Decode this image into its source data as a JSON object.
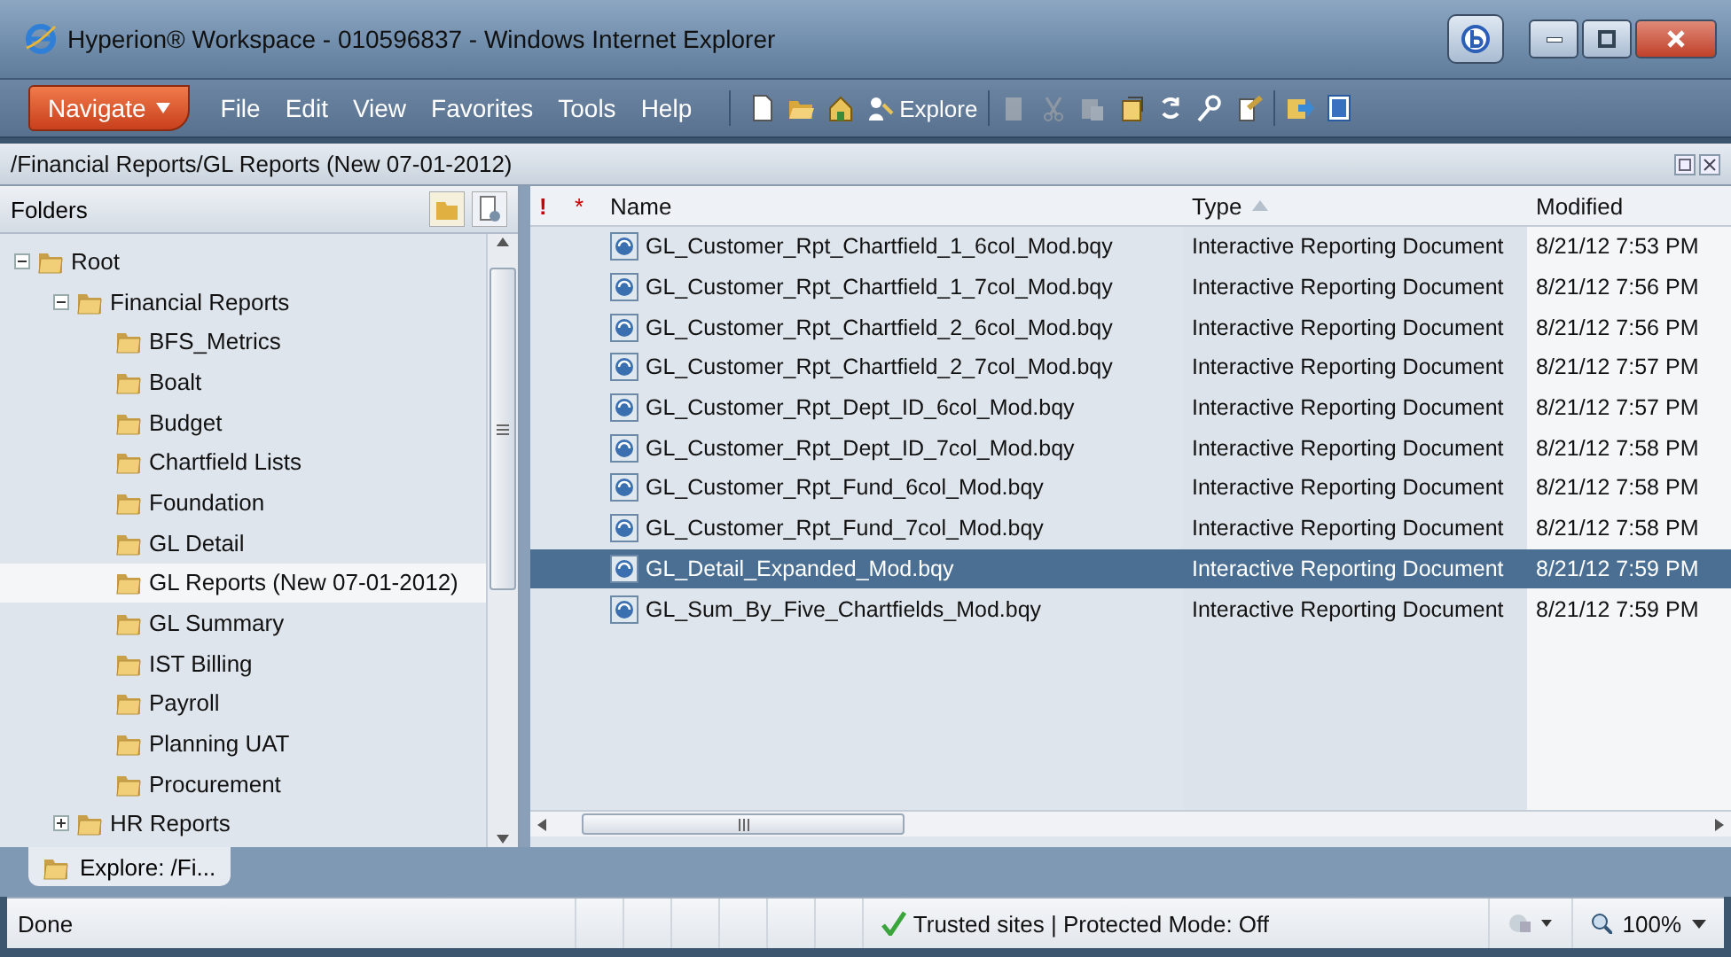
{
  "window": {
    "title": "Hyperion® Workspace - 010596837 - Windows Internet Explorer"
  },
  "toolbar": {
    "navigate": "Navigate",
    "menus": [
      "File",
      "Edit",
      "View",
      "Favorites",
      "Tools",
      "Help"
    ],
    "tools": [
      {
        "kind": "icon",
        "disabled": false
      },
      {
        "kind": "icon",
        "disabled": false
      },
      {
        "kind": "icon",
        "disabled": false
      },
      {
        "kind": "text",
        "label": "Explore",
        "disabled": false
      },
      {
        "kind": "separator"
      },
      {
        "kind": "icon",
        "disabled": true
      },
      {
        "kind": "icon",
        "disabled": true
      },
      {
        "kind": "icon",
        "disabled": true
      },
      {
        "kind": "icon",
        "disabled": false
      },
      {
        "kind": "icon",
        "disabled": false
      },
      {
        "kind": "icon",
        "disabled": false
      },
      {
        "kind": "icon",
        "disabled": false
      },
      {
        "kind": "separator"
      },
      {
        "kind": "icon",
        "disabled": false
      },
      {
        "kind": "icon",
        "disabled": false
      }
    ]
  },
  "path_bar": {
    "path": "/Financial Reports/GL Reports (New 07-01-2012)"
  },
  "folders": {
    "title": "Folders",
    "tree": [
      {
        "label": "Root",
        "expanded": true,
        "selected": false,
        "children": [
          {
            "label": "Financial Reports",
            "expanded": true,
            "selected": false,
            "children": [
              {
                "label": "BFS_Metrics",
                "selected": false
              },
              {
                "label": "Boalt",
                "selected": false
              },
              {
                "label": "Budget",
                "selected": false
              },
              {
                "label": "Chartfield Lists",
                "selected": false
              },
              {
                "label": "Foundation",
                "selected": false
              },
              {
                "label": "GL Detail",
                "selected": false
              },
              {
                "label": "GL Reports (New 07-01-2012)",
                "selected": true
              },
              {
                "label": "GL Summary",
                "selected": false
              },
              {
                "label": "IST Billing",
                "selected": false
              },
              {
                "label": "Payroll",
                "selected": false
              },
              {
                "label": "Planning UAT",
                "selected": false
              },
              {
                "label": "Procurement",
                "selected": false
              }
            ]
          },
          {
            "label": "HR Reports",
            "expanded": false,
            "selected": false
          }
        ]
      }
    ]
  },
  "explore_tab": {
    "label": "Explore: /Fi..."
  },
  "file_list": {
    "columns": [
      {
        "label": "!",
        "sorted": false
      },
      {
        "label": "*",
        "sorted": false
      },
      {
        "label": "Name",
        "sorted": false
      },
      {
        "label": "Type",
        "sorted": true
      },
      {
        "label": "Modified",
        "sorted": false
      }
    ],
    "rows": [
      {
        "name": "GL_Customer_Rpt_Chartfield_1_6col_Mod.bqy",
        "type": "Interactive Reporting Document",
        "modified": "8/21/12 7:53 PM",
        "selected": false
      },
      {
        "name": "GL_Customer_Rpt_Chartfield_1_7col_Mod.bqy",
        "type": "Interactive Reporting Document",
        "modified": "8/21/12 7:56 PM",
        "selected": false
      },
      {
        "name": "GL_Customer_Rpt_Chartfield_2_6col_Mod.bqy",
        "type": "Interactive Reporting Document",
        "modified": "8/21/12 7:56 PM",
        "selected": false
      },
      {
        "name": "GL_Customer_Rpt_Chartfield_2_7col_Mod.bqy",
        "type": "Interactive Reporting Document",
        "modified": "8/21/12 7:57 PM",
        "selected": false
      },
      {
        "name": "GL_Customer_Rpt_Dept_ID_6col_Mod.bqy",
        "type": "Interactive Reporting Document",
        "modified": "8/21/12 7:57 PM",
        "selected": false
      },
      {
        "name": "GL_Customer_Rpt_Dept_ID_7col_Mod.bqy",
        "type": "Interactive Reporting Document",
        "modified": "8/21/12 7:58 PM",
        "selected": false
      },
      {
        "name": "GL_Customer_Rpt_Fund_6col_Mod.bqy",
        "type": "Interactive Reporting Document",
        "modified": "8/21/12 7:58 PM",
        "selected": false
      },
      {
        "name": "GL_Customer_Rpt_Fund_7col_Mod.bqy",
        "type": "Interactive Reporting Document",
        "modified": "8/21/12 7:58 PM",
        "selected": false
      },
      {
        "name": "GL_Detail_Expanded_Mod.bqy",
        "type": "Interactive Reporting Document",
        "modified": "8/21/12 7:59 PM",
        "selected": true
      },
      {
        "name": "GL_Sum_By_Five_Chartfields_Mod.bqy",
        "type": "Interactive Reporting Document",
        "modified": "8/21/12 7:59 PM",
        "selected": false
      }
    ]
  },
  "status_bar": {
    "status": "Done",
    "zone": "Trusted sites | Protected Mode: Off",
    "zoom": "100%"
  }
}
